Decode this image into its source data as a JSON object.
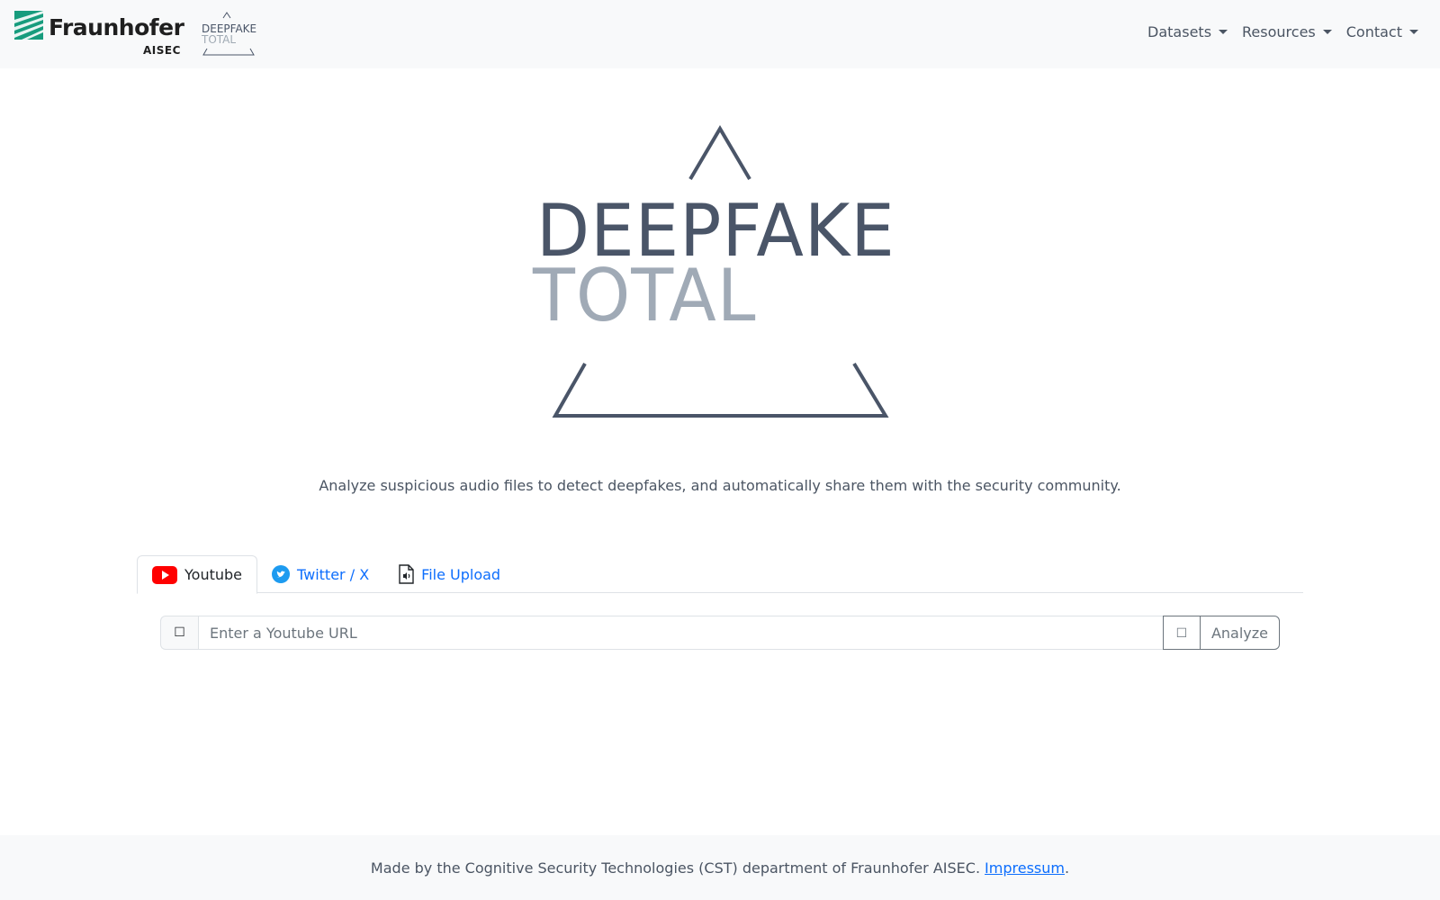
{
  "brand": {
    "fraunhofer_name": "Fraunhofer",
    "fraunhofer_sub": "AISEC",
    "logo_small_line1": "DEEPFAKE",
    "logo_small_line2": "TOTAL",
    "colors": {
      "fraunhofer_green": "#179c7d",
      "dark": "#4a5568",
      "light": "#a0aab6"
    }
  },
  "nav": {
    "items": [
      {
        "label": "Datasets"
      },
      {
        "label": "Resources"
      },
      {
        "label": "Contact"
      }
    ]
  },
  "hero": {
    "word1": "DEEPFAKE",
    "word2": "TOTAL",
    "tagline": "Analyze suspicious audio files to detect deepfakes, and automatically share them with the security community."
  },
  "tabs": [
    {
      "label": "Youtube",
      "icon": "youtube-icon",
      "active": true
    },
    {
      "label": "Twitter / X",
      "icon": "twitter-icon",
      "active": false
    },
    {
      "label": "File Upload",
      "icon": "audio-file-icon",
      "active": false
    }
  ],
  "input": {
    "prefix_glyph": "☐",
    "placeholder": "Enter a Youtube URL",
    "value": "",
    "clear_glyph": "☐",
    "analyze_label": "Analyze"
  },
  "footer": {
    "text": "Made by the Cognitive Security Technologies (CST) department of Fraunhofer AISEC.",
    "link_label": "Impressum",
    "trailing": "."
  }
}
